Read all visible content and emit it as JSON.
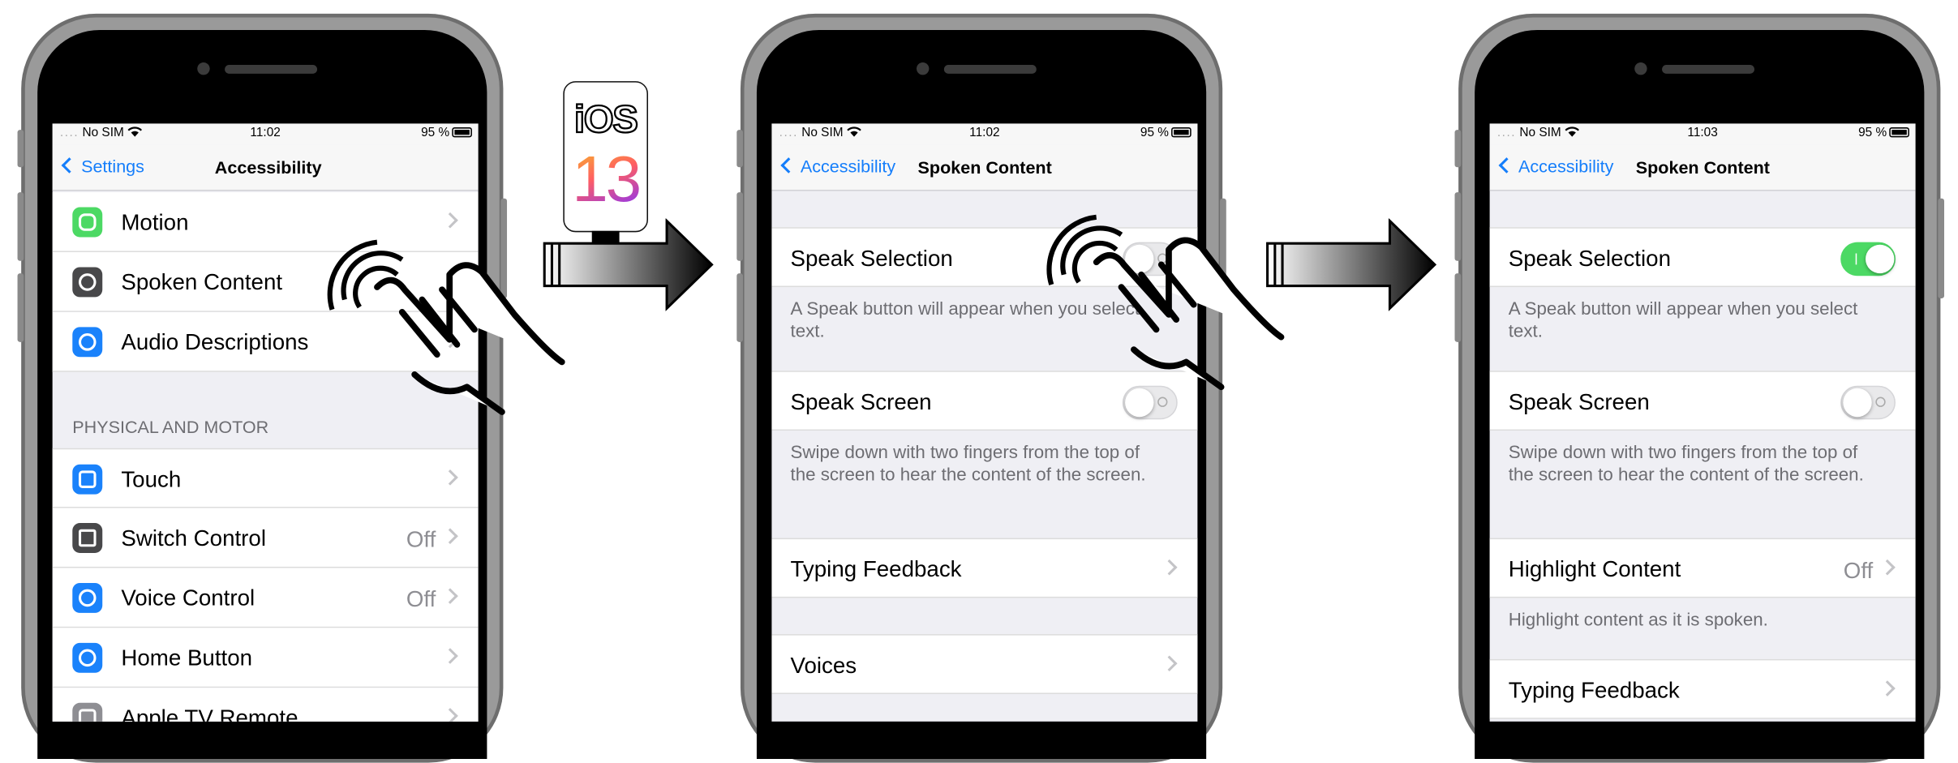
{
  "ios_badge": {
    "line1": "iOS",
    "line2": "13"
  },
  "status": {
    "carrier": "No SIM",
    "battery": "95 %",
    "time1": "11:02",
    "time2": "11:02",
    "time3": "11:03"
  },
  "phone1": {
    "back": "Settings",
    "title": "Accessibility",
    "rows": [
      {
        "label": "Motion",
        "value": "",
        "icon": "motion-icon",
        "color": "#4cd964"
      },
      {
        "label": "Spoken Content",
        "value": "",
        "icon": "spoken-content-icon",
        "color": "#48484a"
      },
      {
        "label": "Audio Descriptions",
        "value": "",
        "icon": "audio-descriptions-icon",
        "color": "#1a82fb"
      }
    ],
    "section_header": "PHYSICAL AND MOTOR",
    "rows2": [
      {
        "label": "Touch",
        "value": "",
        "icon": "touch-icon",
        "color": "#1a82fb"
      },
      {
        "label": "Switch Control",
        "value": "Off",
        "icon": "switch-control-icon",
        "color": "#48484a"
      },
      {
        "label": "Voice Control",
        "value": "Off",
        "icon": "voice-control-icon",
        "color": "#1a82fb"
      },
      {
        "label": "Home Button",
        "value": "",
        "icon": "home-button-icon",
        "color": "#1a82fb"
      },
      {
        "label": "Apple TV Remote",
        "value": "",
        "icon": "apple-tv-remote-icon",
        "color": "#8e8e93"
      }
    ]
  },
  "phone2": {
    "back": "Accessibility",
    "title": "Spoken Content",
    "speak_selection": "Speak Selection",
    "speak_selection_on": false,
    "speak_selection_footer": "A Speak button will appear when you select text.",
    "speak_screen": "Speak Screen",
    "speak_screen_on": false,
    "speak_screen_footer": "Swipe down with two fingers from the top of the screen to hear the content of the screen.",
    "typing_feedback": "Typing Feedback",
    "voices": "Voices"
  },
  "phone3": {
    "back": "Accessibility",
    "title": "Spoken Content",
    "speak_selection": "Speak Selection",
    "speak_selection_on": true,
    "speak_selection_footer": "A Speak button will appear when you select text.",
    "speak_screen": "Speak Screen",
    "speak_screen_on": false,
    "speak_screen_footer": "Swipe down with two fingers from the top of the screen to hear the content of the screen.",
    "highlight_content": "Highlight Content",
    "highlight_content_value": "Off",
    "highlight_content_footer": "Highlight content as it is spoken.",
    "typing_feedback": "Typing Feedback"
  },
  "colors": {
    "ios_blue": "#157efb",
    "toggle_on": "#4cd964",
    "grouped_bg": "#efeff4"
  }
}
